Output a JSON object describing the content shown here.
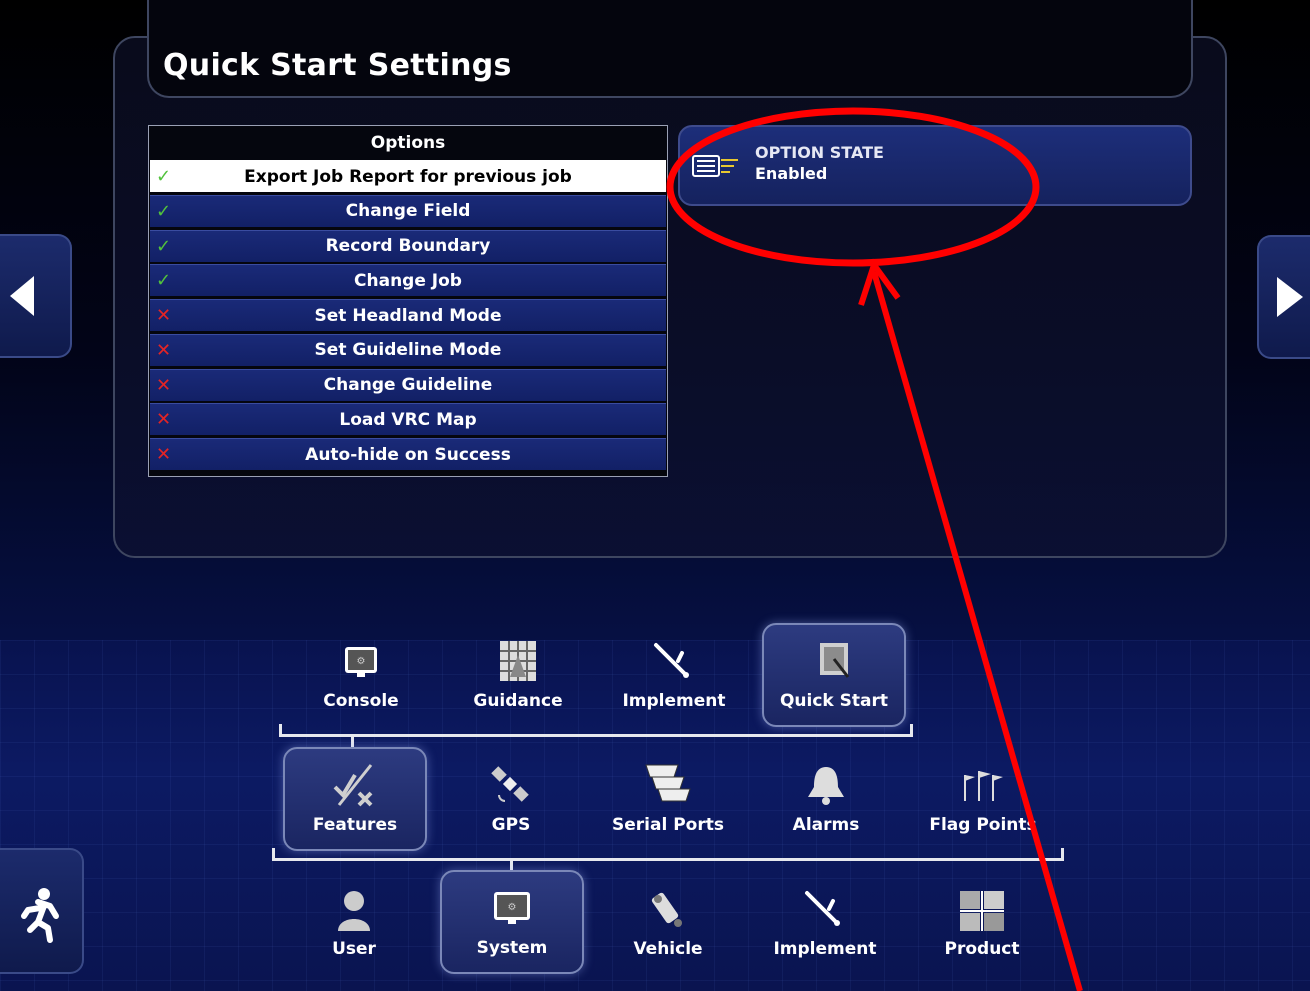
{
  "header": {
    "title": "Quick Start Settings"
  },
  "options": {
    "header": "Options",
    "items": [
      {
        "label": "Export Job Report for previous job",
        "state": "enabled",
        "mark": "✓",
        "selected": true
      },
      {
        "label": "Change Field",
        "state": "enabled",
        "mark": "✓"
      },
      {
        "label": "Record Boundary",
        "state": "enabled",
        "mark": "✓"
      },
      {
        "label": "Change Job",
        "state": "enabled",
        "mark": "✓"
      },
      {
        "label": "Set Headland Mode",
        "state": "disabled",
        "mark": "✕"
      },
      {
        "label": "Set Guideline Mode",
        "state": "disabled",
        "mark": "✕"
      },
      {
        "label": "Change Guideline",
        "state": "disabled",
        "mark": "✕"
      },
      {
        "label": "Load VRC Map",
        "state": "disabled",
        "mark": "✕"
      },
      {
        "label": "Auto-hide on Success",
        "state": "disabled",
        "mark": "✕"
      }
    ]
  },
  "option_state": {
    "label": "OPTION STATE",
    "value": "Enabled"
  },
  "nav": {
    "row1": [
      {
        "label": "Console",
        "icon": "console-icon"
      },
      {
        "label": "Guidance",
        "icon": "guidance-icon"
      },
      {
        "label": "Implement",
        "icon": "implement-icon"
      },
      {
        "label": "Quick Start",
        "icon": "quick-start-icon",
        "selected": true
      }
    ],
    "row2": [
      {
        "label": "Features",
        "icon": "features-icon",
        "selected": true
      },
      {
        "label": "GPS",
        "icon": "satellite-icon"
      },
      {
        "label": "Serial Ports",
        "icon": "serial-port-icon"
      },
      {
        "label": "Alarms",
        "icon": "bell-icon"
      },
      {
        "label": "Flag Points",
        "icon": "flags-icon"
      }
    ],
    "row3": [
      {
        "label": "User",
        "icon": "user-icon"
      },
      {
        "label": "System",
        "icon": "system-icon",
        "selected": true
      },
      {
        "label": "Vehicle",
        "icon": "vehicle-icon"
      },
      {
        "label": "Implement",
        "icon": "implement-icon"
      },
      {
        "label": "Product",
        "icon": "product-icon"
      }
    ]
  },
  "colors": {
    "check": "#52c23c",
    "cross": "#e52424",
    "annotation": "#ff0000",
    "row": "#16246c"
  }
}
